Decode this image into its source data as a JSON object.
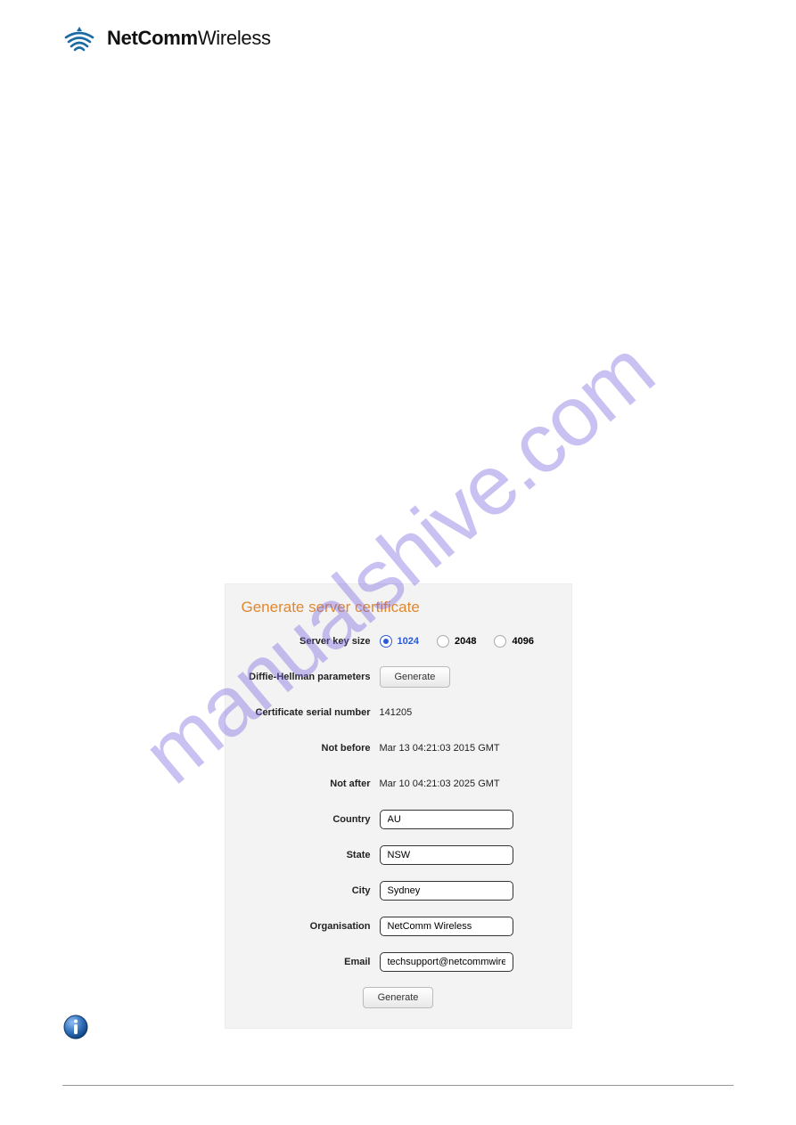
{
  "header": {
    "brand_bold": "NetComm",
    "brand_light": "Wireless"
  },
  "watermark": "manualshive.com",
  "panel": {
    "title": "Generate server certificate",
    "labels": {
      "key_size": "Server key size",
      "dh": "Diffie-Hellman parameters",
      "serial": "Certificate serial number",
      "not_before": "Not before",
      "not_after": "Not after",
      "country": "Country",
      "state": "State",
      "city": "City",
      "org": "Organisation",
      "email": "Email"
    },
    "key_size_options": [
      "1024",
      "2048",
      "4096"
    ],
    "key_size_selected": "1024",
    "dh_button": "Generate",
    "serial_value": "141205",
    "not_before_value": "Mar 13 04:21:03 2015 GMT",
    "not_after_value": "Mar 10 04:21:03 2025 GMT",
    "country_value": "AU",
    "state_value": "NSW",
    "city_value": "Sydney",
    "org_value": "NetComm Wireless",
    "email_value": "techsupport@netcommwirele",
    "submit_button": "Generate"
  }
}
